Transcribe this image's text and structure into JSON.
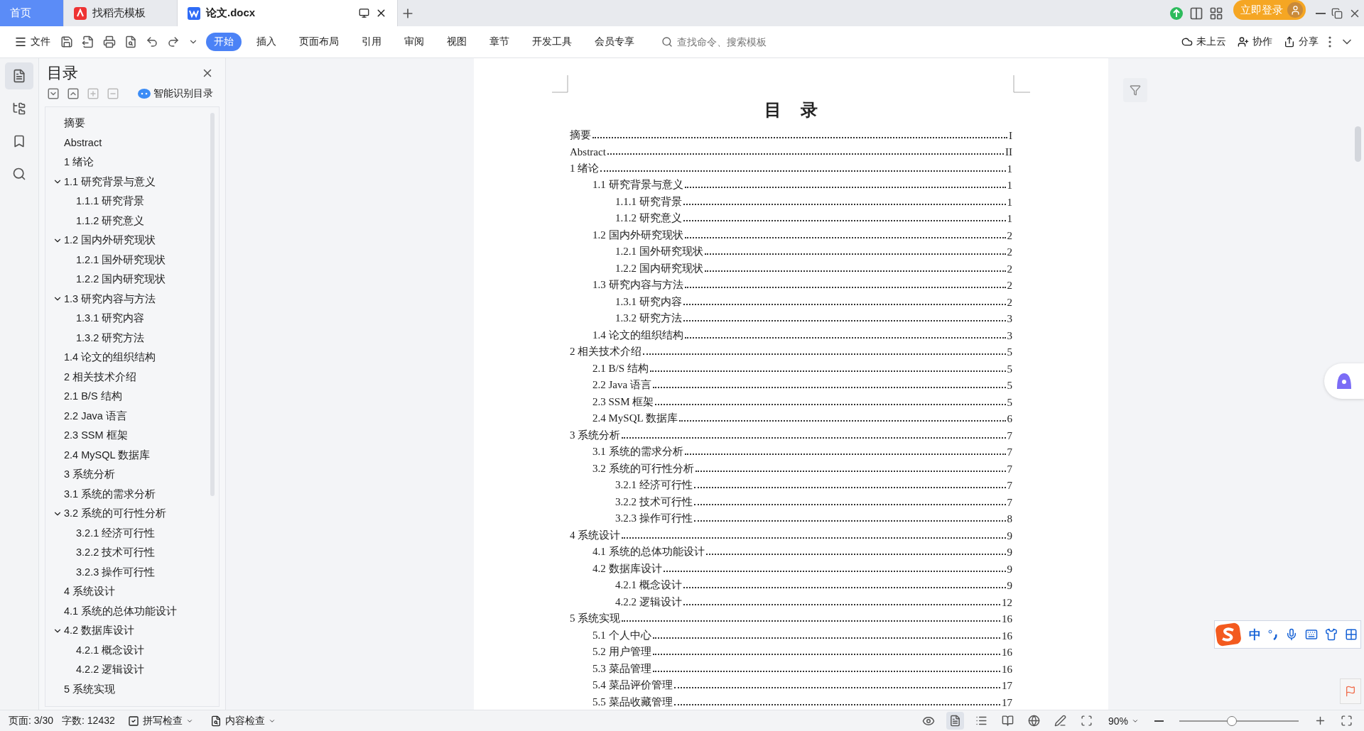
{
  "tabs": [
    {
      "kind": "home",
      "label": "首页",
      "selected": false
    },
    {
      "kind": "docer",
      "label": "找稻壳模板",
      "selected": false
    },
    {
      "kind": "doc",
      "label": "论文.docx",
      "selected": true
    }
  ],
  "account": {
    "login": "立即登录"
  },
  "toolbar": {
    "file_menu": "文件",
    "ribbon_tabs": [
      {
        "label": "开始",
        "selected": true
      },
      {
        "label": "插入",
        "selected": false
      },
      {
        "label": "页面布局",
        "selected": false
      },
      {
        "label": "引用",
        "selected": false
      },
      {
        "label": "审阅",
        "selected": false
      },
      {
        "label": "视图",
        "selected": false
      },
      {
        "label": "章节",
        "selected": false
      },
      {
        "label": "开发工具",
        "selected": false
      },
      {
        "label": "会员专享",
        "selected": false
      }
    ],
    "search": {
      "placeholder": "查找命令、搜索模板"
    },
    "actions": [
      {
        "kind": "cloud",
        "label": "未上云"
      },
      {
        "kind": "collab",
        "label": "协作"
      },
      {
        "kind": "share",
        "label": "分享"
      }
    ]
  },
  "sidebar_rail": [
    {
      "kind": "toc",
      "selected": true
    },
    {
      "kind": "nav",
      "selected": false
    },
    {
      "kind": "bookmark",
      "selected": false
    },
    {
      "kind": "search",
      "selected": false
    }
  ],
  "toc_panel": {
    "title": "目录",
    "smart_button": "智能识别目录",
    "items": [
      {
        "label": "摘要"
      },
      {
        "label": "Abstract"
      },
      {
        "label": "1 绪论"
      },
      {
        "label": "1.1 研究背景与意义",
        "expanded": true,
        "children": [
          {
            "label": "1.1.1 研究背景"
          },
          {
            "label": "1.1.2 研究意义"
          }
        ]
      },
      {
        "label": "1.2 国内外研究现状",
        "expanded": true,
        "children": [
          {
            "label": "1.2.1 国外研究现状"
          },
          {
            "label": "1.2.2 国内研究现状"
          }
        ]
      },
      {
        "label": "1.3 研究内容与方法",
        "expanded": true,
        "children": [
          {
            "label": "1.3.1 研究内容"
          },
          {
            "label": "1.3.2 研究方法"
          }
        ]
      },
      {
        "label": "1.4 论文的组织结构"
      },
      {
        "label": "2 相关技术介绍"
      },
      {
        "label": "2.1 B/S 结构"
      },
      {
        "label": "2.2 Java 语言"
      },
      {
        "label": "2.3 SSM 框架"
      },
      {
        "label": "2.4 MySQL 数据库"
      },
      {
        "label": "3 系统分析"
      },
      {
        "label": "3.1 系统的需求分析"
      },
      {
        "label": "3.2 系统的可行性分析",
        "expanded": true,
        "children": [
          {
            "label": "3.2.1 经济可行性"
          },
          {
            "label": "3.2.2 技术可行性"
          },
          {
            "label": "3.2.3 操作可行性"
          }
        ]
      },
      {
        "label": "4 系统设计"
      },
      {
        "label": "4.1 系统的总体功能设计"
      },
      {
        "label": "4.2 数据库设计",
        "expanded": true,
        "children": [
          {
            "label": "4.2.1 概念设计"
          },
          {
            "label": "4.2.2 逻辑设计"
          }
        ]
      },
      {
        "label": "5 系统实现"
      }
    ]
  },
  "document": {
    "title": "目 录",
    "entries": [
      {
        "title": "摘要",
        "page": "I"
      },
      {
        "title": "Abstract",
        "page": "II"
      },
      {
        "title": "1 绪论",
        "page": "1",
        "children": [
          {
            "title": "1.1 研究背景与意义",
            "page": "1",
            "children": [
              {
                "title": "1.1.1 研究背景",
                "page": "1"
              },
              {
                "title": "1.1.2 研究意义",
                "page": "1"
              }
            ]
          },
          {
            "title": "1.2 国内外研究现状",
            "page": "2",
            "children": [
              {
                "title": "1.2.1 国外研究现状",
                "page": "2"
              },
              {
                "title": "1.2.2 国内研究现状",
                "page": "2"
              }
            ]
          },
          {
            "title": "1.3 研究内容与方法",
            "page": "2",
            "children": [
              {
                "title": "1.3.1 研究内容",
                "page": "2"
              },
              {
                "title": "1.3.2 研究方法",
                "page": "3"
              }
            ]
          },
          {
            "title": "1.4 论文的组织结构",
            "page": "3"
          }
        ]
      },
      {
        "title": "2 相关技术介绍",
        "page": "5",
        "children": [
          {
            "title": "2.1 B/S 结构",
            "page": "5"
          },
          {
            "title": "2.2 Java 语言",
            "page": "5"
          },
          {
            "title": "2.3 SSM 框架",
            "page": "5"
          },
          {
            "title": "2.4 MySQL 数据库",
            "page": "6"
          }
        ]
      },
      {
        "title": "3 系统分析",
        "page": "7",
        "children": [
          {
            "title": "3.1 系统的需求分析",
            "page": "7"
          },
          {
            "title": "3.2 系统的可行性分析",
            "page": "7",
            "children": [
              {
                "title": "3.2.1 经济可行性",
                "page": "7"
              },
              {
                "title": "3.2.2 技术可行性",
                "page": "7"
              },
              {
                "title": "3.2.3 操作可行性",
                "page": "8"
              }
            ]
          }
        ]
      },
      {
        "title": "4 系统设计",
        "page": "9",
        "children": [
          {
            "title": "4.1 系统的总体功能设计",
            "page": "9"
          },
          {
            "title": "4.2 数据库设计",
            "page": "9",
            "children": [
              {
                "title": "4.2.1 概念设计",
                "page": "9"
              },
              {
                "title": "4.2.2 逻辑设计",
                "page": "12"
              }
            ]
          }
        ]
      },
      {
        "title": "5 系统实现",
        "page": "16",
        "children": [
          {
            "title": "5.1 个人中心",
            "page": "16"
          },
          {
            "title": "5.2 用户管理",
            "page": "16"
          },
          {
            "title": "5.3 菜品管理",
            "page": "16"
          },
          {
            "title": "5.4 菜品评价管理",
            "page": "17"
          },
          {
            "title": "5.5 菜品收藏管理",
            "page": "17"
          }
        ]
      }
    ]
  },
  "ime": {
    "mode": "中"
  },
  "status_bar": {
    "page": "页面: 3/30",
    "words": "字数: 12432",
    "spell_check": "拼写检查",
    "content_check": "内容检查",
    "zoom": "90%",
    "view_modes": [
      {
        "kind": "page",
        "selected": true
      },
      {
        "kind": "outline",
        "selected": false
      },
      {
        "kind": "read",
        "selected": false
      },
      {
        "kind": "web",
        "selected": false
      },
      {
        "kind": "write",
        "selected": false
      }
    ],
    "zoom_slider": {
      "level": 0.44
    }
  }
}
